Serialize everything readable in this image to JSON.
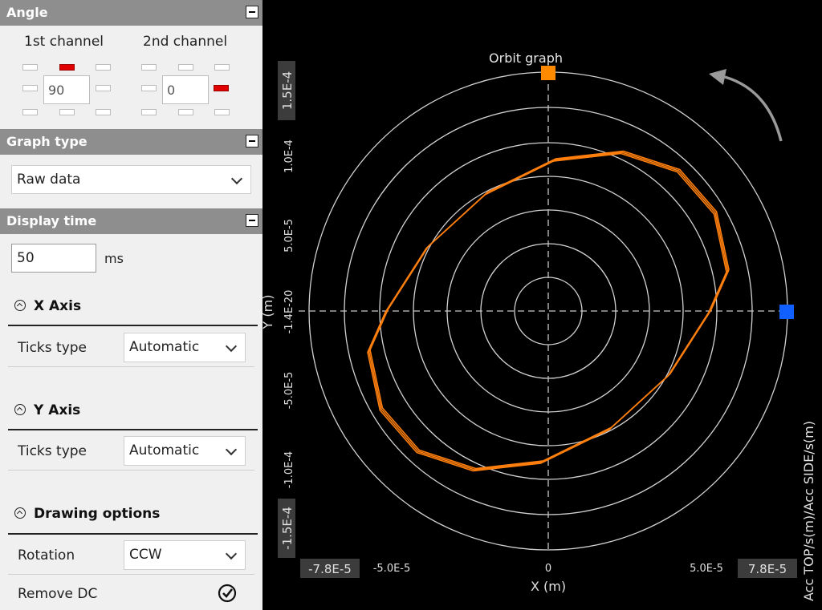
{
  "panel": {
    "angle": {
      "title": "Angle",
      "channel1_label": "1st channel",
      "channel2_label": "2nd channel",
      "channel1_value": "90",
      "channel2_value": "0"
    },
    "graph_type": {
      "title": "Graph type",
      "selected": "Raw data"
    },
    "display_time": {
      "title": "Display time",
      "value": "50",
      "unit": "ms"
    },
    "x_axis": {
      "title": "X Axis",
      "ticks_label": "Ticks type",
      "ticks_value": "Automatic"
    },
    "y_axis": {
      "title": "Y Axis",
      "ticks_label": "Ticks type",
      "ticks_value": "Automatic"
    },
    "drawing": {
      "title": "Drawing options",
      "rotation_label": "Rotation",
      "rotation_value": "CCW",
      "remove_dc_label": "Remove DC",
      "remove_dc_checked": true
    }
  },
  "colors": {
    "trace": "#ff7f0e",
    "marker_top": "#ff8a00",
    "marker_side": "#1060ff",
    "panel_header": "#8e8e8e"
  },
  "chart_data": {
    "type": "scatter",
    "title": "Orbit graph",
    "xlabel": "X (m)",
    "ylabel": "Y (m)",
    "side_label": "Acc TOP/s(m)/Acc SIDE/s(m)",
    "xlim": [
      -7.8e-05,
      7.8e-05
    ],
    "ylim": [
      -0.00015,
      0.00015
    ],
    "x_ticks": [
      "-7.8E-5",
      "-5.0E-5",
      "0",
      "5.0E-5",
      "7.8E-5"
    ],
    "y_ticks": [
      "1.5E-4",
      "1.0E-4",
      "5.0E-5",
      "-1.4E-20",
      "-5.0E-5",
      "-1.0E-4",
      "-1.5E-4"
    ],
    "polar_rings": 7,
    "rotation": "CCW",
    "series": [
      {
        "x": [
          5.81e-05,
          5.41e-05,
          4.22e-05,
          2.39e-05,
          2e-06,
          -2.01e-05,
          -3.91e-05,
          -5.23e-05,
          -5.81e-05,
          -5.41e-05,
          -4.22e-05,
          -2.39e-05,
          -2e-06,
          2.01e-05,
          3.91e-05,
          5.23e-05,
          5.81e-05
        ],
        "y": [
          2.5e-05,
          6.12e-05,
          8.75e-05,
          9.9e-05,
          9.42e-05,
          7.33e-05,
          3.99e-05,
          2e-07,
          -2.5e-05,
          -6.12e-05,
          -8.75e-05,
          -9.9e-05,
          -9.42e-05,
          -7.33e-05,
          -3.99e-05,
          -2e-07,
          2.5e-05
        ]
      }
    ]
  }
}
